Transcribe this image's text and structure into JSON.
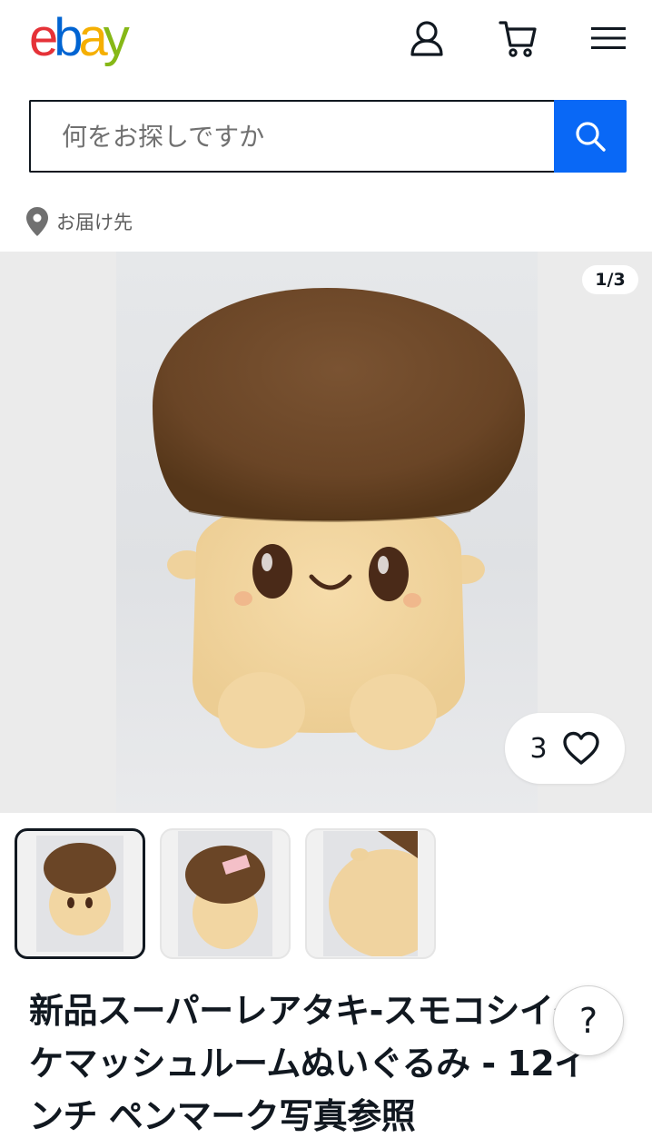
{
  "header": {
    "logo_letters": [
      "e",
      "b",
      "a",
      "y"
    ],
    "logo_colors": [
      "#e53238",
      "#0064d2",
      "#f5af02",
      "#86b817"
    ],
    "icons": [
      "account-icon",
      "cart-icon",
      "menu-icon"
    ]
  },
  "search": {
    "placeholder": "何をお探しですか",
    "button_icon": "search-icon",
    "button_color": "#0968f6"
  },
  "deliver": {
    "icon": "location-pin-icon",
    "label": "お届け先"
  },
  "gallery": {
    "counter": "1/3",
    "watch_count": "3",
    "watch_icon": "heart-icon",
    "thumbnail_count": 3,
    "active_thumbnail": 1
  },
  "product": {
    "title": "新品スーパーレアタキ-スモコシイタケマッシュルームぬいぐるみ - 12インチ ペンマーク写真参照"
  },
  "help": {
    "label": "?"
  }
}
